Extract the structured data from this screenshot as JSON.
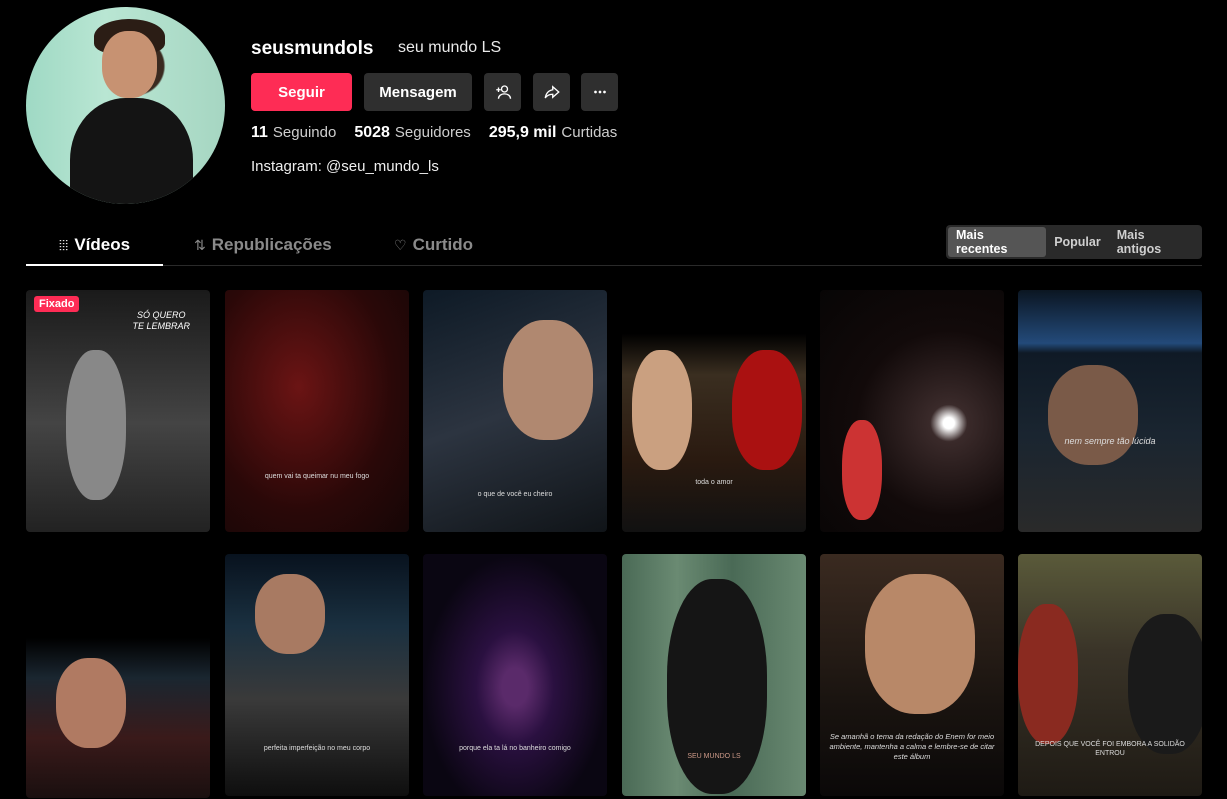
{
  "profile": {
    "username": "seusmundols",
    "nickname": "seu mundo LS",
    "bio": "Instagram: @seu_mundo_ls"
  },
  "actions": {
    "follow_label": "Seguir",
    "message_label": "Mensagem",
    "add_user_icon": "add-user-icon",
    "share_icon": "share-icon",
    "more_icon": "more-icon"
  },
  "stats": [
    {
      "value": "11",
      "label": "Seguindo"
    },
    {
      "value": "5028",
      "label": "Seguidores"
    },
    {
      "value": "295,9 mil",
      "label": "Curtidas"
    }
  ],
  "tabs": [
    {
      "label": "Vídeos",
      "icon": "grid-lines-icon",
      "active": true
    },
    {
      "label": "Republicações",
      "icon": "repost-icon",
      "active": false
    },
    {
      "label": "Curtido",
      "icon": "heart-icon",
      "active": false
    }
  ],
  "sort": [
    {
      "label": "Mais recentes",
      "active": true
    },
    {
      "label": "Popular",
      "active": false
    },
    {
      "label": "Mais antigos",
      "active": false
    }
  ],
  "videos": [
    {
      "badge": "Fixado",
      "overlay": "SÓ QUERO\nTE LEMBRAR",
      "caption": ""
    },
    {
      "caption": "quem vai ta queimar nu meu fogo"
    },
    {
      "caption": "o que de você eu cheiro"
    },
    {
      "caption": "toda o amor"
    },
    {
      "caption": ""
    },
    {
      "caption": "nem sempre tão lúcida"
    },
    {
      "caption": ""
    },
    {
      "caption": "perfeita imperfeição no meu corpo"
    },
    {
      "caption": "porque ela ta lá no banheiro comigo"
    },
    {
      "caption": "SEU MUNDO LS"
    },
    {
      "caption": "Se amanhã o tema da redação do Enem for meio ambiente, mantenha a calma e lembre-se de citar este álbum"
    },
    {
      "caption": "DEPOIS QUE VOCÊ FOI EMBORA A SOLIDÃO ENTROU"
    }
  ],
  "colors": {
    "accent": "#fe2c55",
    "button_dark": "#2f2f2f",
    "background": "#000000"
  }
}
